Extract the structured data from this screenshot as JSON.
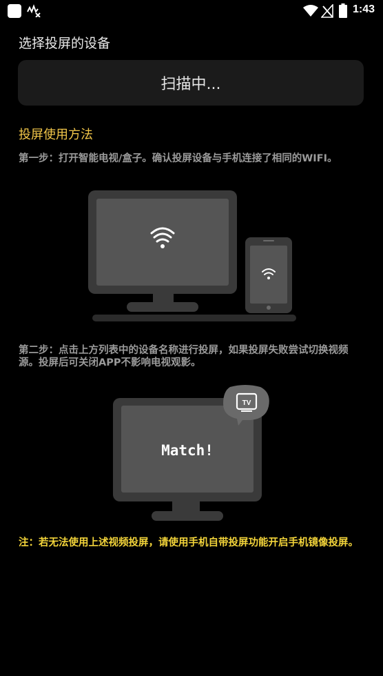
{
  "status_bar": {
    "time": "1:43",
    "icons": [
      "app-square-icon",
      "notification-icon",
      "wifi-icon",
      "signal-icon",
      "battery-icon"
    ]
  },
  "page": {
    "title": "选择投屏的设备",
    "scan_status": "扫描中...",
    "howto_title": "投屏使用方法",
    "step1": "第一步：打开智能电视/盒子。确认投屏设备与手机连接了相同的WIFI。",
    "step2": "第二步：点击上方列表中的设备名称进行投屏，如果投屏失败尝试切换视频源。投屏后可关闭APP不影响电视观影。",
    "match_label": "Match!",
    "tv_badge": "TV",
    "note": "注：若无法使用上述视频投屏，请使用手机自带投屏功能开启手机镜像投屏。"
  },
  "colors": {
    "background": "#000000",
    "accent_yellow": "#f3c74a",
    "note_yellow": "#f3d43a",
    "muted_text": "#9a9a9a",
    "card_bg": "#1b1b1b"
  }
}
